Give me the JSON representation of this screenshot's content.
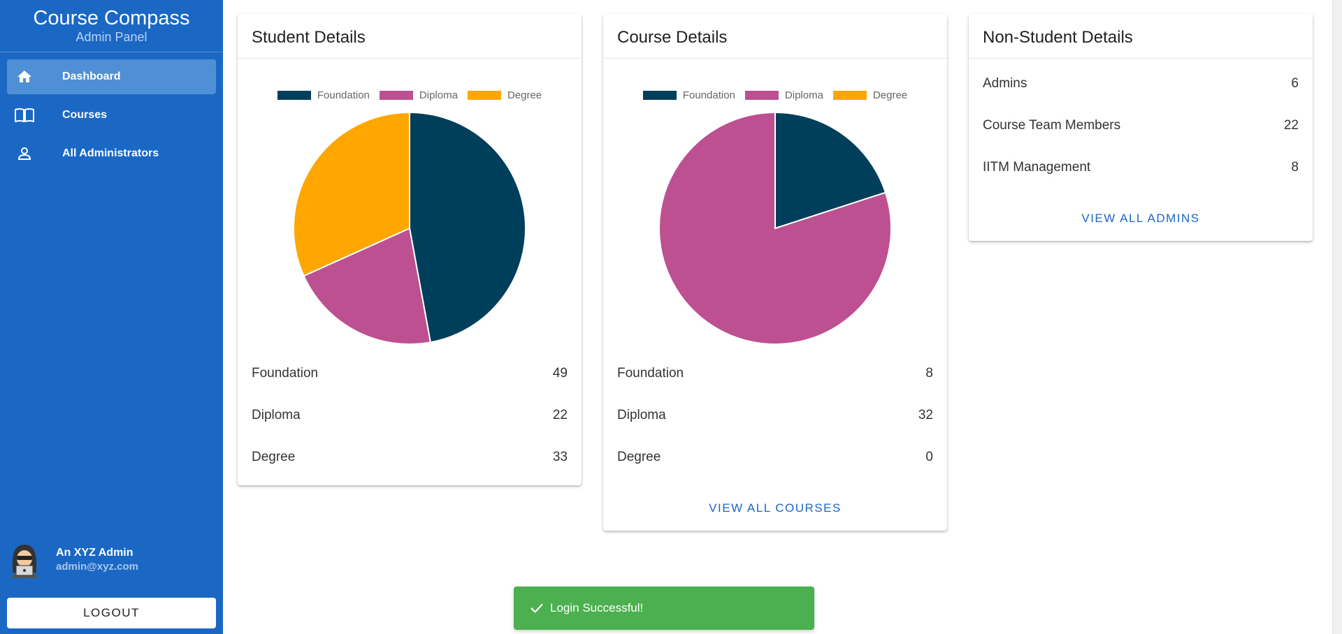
{
  "sidebar": {
    "title": "Course Compass",
    "subtitle": "Admin Panel",
    "items": [
      {
        "label": "Dashboard",
        "icon": "home-icon"
      },
      {
        "label": "Courses",
        "icon": "book-icon"
      },
      {
        "label": "All Administrators",
        "icon": "person-icon"
      }
    ],
    "user": {
      "name": "An XYZ Admin",
      "email": "admin@xyz.com"
    },
    "logout_label": "LOGOUT"
  },
  "student_card": {
    "title": "Student Details",
    "legend": [
      "Foundation",
      "Diploma",
      "Degree"
    ],
    "rows": [
      {
        "label": "Foundation",
        "value": "49"
      },
      {
        "label": "Diploma",
        "value": "22"
      },
      {
        "label": "Degree",
        "value": "33"
      }
    ]
  },
  "course_card": {
    "title": "Course Details",
    "legend": [
      "Foundation",
      "Diploma",
      "Degree"
    ],
    "rows": [
      {
        "label": "Foundation",
        "value": "8"
      },
      {
        "label": "Diploma",
        "value": "32"
      },
      {
        "label": "Degree",
        "value": "0"
      }
    ],
    "action": "VIEW ALL COURSES"
  },
  "nonstudent_card": {
    "title": "Non-Student Details",
    "rows": [
      {
        "label": "Admins",
        "value": "6"
      },
      {
        "label": "Course Team Members",
        "value": "22"
      },
      {
        "label": "IITM Management",
        "value": "8"
      }
    ],
    "action": "VIEW ALL ADMINS"
  },
  "toast": {
    "message": "Login Successful!"
  },
  "colors": {
    "sidebar": "#1a67c4",
    "foundation": "#003f5c",
    "diploma": "#bc5090",
    "degree": "#ffa600",
    "success": "#4caf50"
  },
  "chart_data": [
    {
      "type": "pie",
      "title": "",
      "categories": [
        "Foundation",
        "Diploma",
        "Degree"
      ],
      "values": [
        49,
        22,
        33
      ],
      "colors": [
        "#003f5c",
        "#bc5090",
        "#ffa600"
      ],
      "legend": "top"
    },
    {
      "type": "pie",
      "title": "",
      "categories": [
        "Foundation",
        "Diploma",
        "Degree"
      ],
      "values": [
        8,
        32,
        0
      ],
      "colors": [
        "#003f5c",
        "#bc5090",
        "#ffa600"
      ],
      "legend": "top"
    }
  ]
}
